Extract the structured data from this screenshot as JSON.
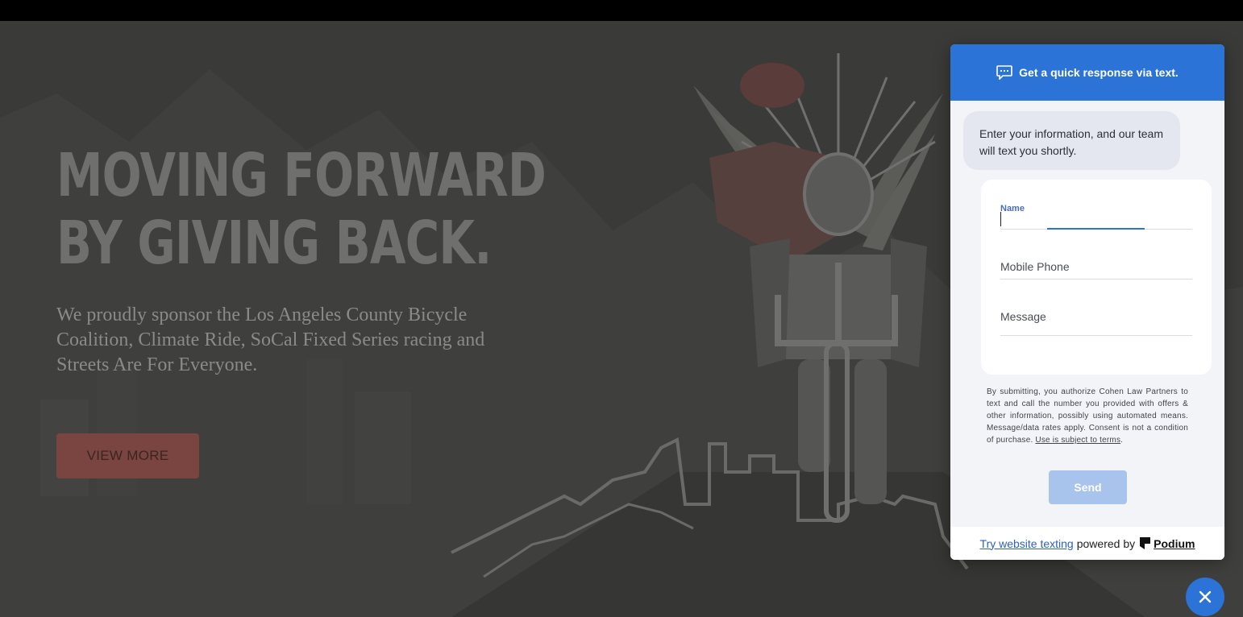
{
  "hero": {
    "headline_line1": "MOVING FORWARD",
    "headline_line2": "BY GIVING BACK.",
    "subtext": "We proudly sponsor the Los Angeles County Bicycle Coalition, Climate Ride, SoCal Fixed Series racing and Streets Are For Everyone.",
    "cta_label": "VIEW MORE"
  },
  "widget": {
    "header_title": "Get a quick response via text.",
    "intro_message": "Enter your information, and our team will text you shortly.",
    "fields": {
      "name_label": "Name",
      "name_value": "",
      "phone_placeholder": "Mobile Phone",
      "message_placeholder": "Message"
    },
    "disclaimer_text": "By submitting, you authorize Cohen Law Partners to text and call the number you provided with offers & other information, possibly using automated means. Message/data rates apply. Consent is not a condition of purchase.",
    "disclaimer_link": "Use is subject to terms",
    "disclaimer_end": ".",
    "send_label": "Send",
    "footer_link": "Try website texting",
    "footer_powered": "powered by",
    "footer_brand": "Podium"
  },
  "icons": {
    "header_icon": "chat-bubble-icon",
    "close_icon": "close-icon",
    "brand_icon": "podium-logo-icon"
  },
  "colors": {
    "accent": "#2b73d6",
    "hero_bg": "#3a3a38",
    "cta_bg": "#7a4440",
    "send_disabled": "#a8c3ec"
  }
}
